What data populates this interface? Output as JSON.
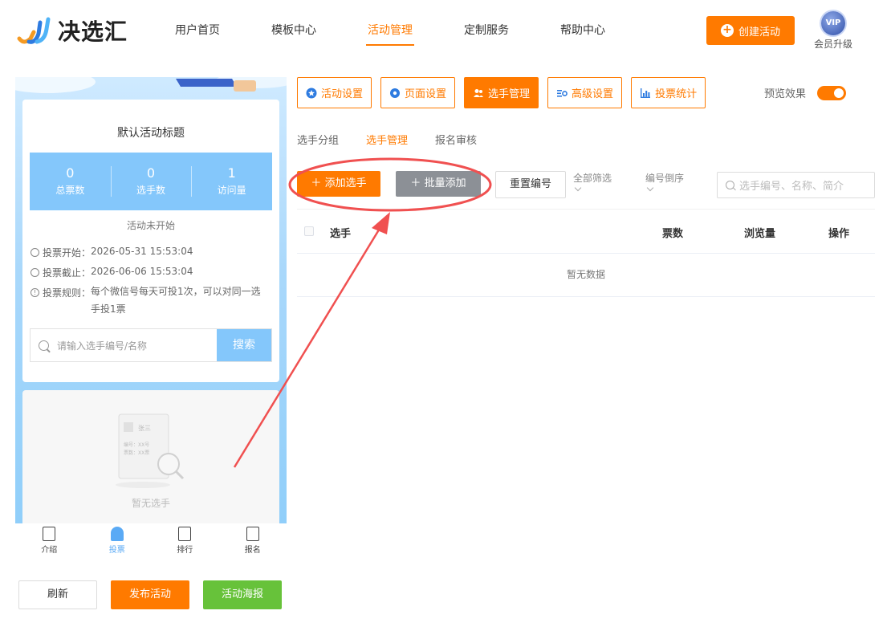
{
  "brand": {
    "name": "决选汇"
  },
  "nav": [
    {
      "label": "用户首页",
      "active": false
    },
    {
      "label": "模板中心",
      "active": false
    },
    {
      "label": "活动管理",
      "active": true
    },
    {
      "label": "定制服务",
      "active": false
    },
    {
      "label": "帮助中心",
      "active": false
    }
  ],
  "header": {
    "create_label": "创建活动",
    "vip_badge": "VIP",
    "vip_label": "会员升级"
  },
  "preview": {
    "title": "默认活动标题",
    "stats": [
      {
        "value": "0",
        "label": "总票数"
      },
      {
        "value": "0",
        "label": "选手数"
      },
      {
        "value": "1",
        "label": "访问量"
      }
    ],
    "status": "活动未开始",
    "vote_start_label": "投票开始：",
    "vote_start": "2026-05-31 15:53:04",
    "vote_end_label": "投票截止：",
    "vote_end": "2026-06-06 15:53:04",
    "rule_label": "投票规则：",
    "rule": "每个微信号每天可投1次，可以对同一选手投1票",
    "search_placeholder": "请输入选手编号/名称",
    "search_button": "搜索",
    "empty_sample_name": "张三",
    "empty_sample_no": "编号：XX号",
    "empty_sample_votes": "票数：XX票",
    "empty_text": "暂无选手",
    "tabbar": [
      {
        "label": "介绍",
        "icon": "intro-icon",
        "active": false
      },
      {
        "label": "投票",
        "icon": "vote-user-icon",
        "active": true
      },
      {
        "label": "排行",
        "icon": "ranking-icon",
        "active": false
      },
      {
        "label": "报名",
        "icon": "signup-icon",
        "active": false
      }
    ]
  },
  "bottom_buttons": {
    "refresh": "刷新",
    "publish": "发布活动",
    "poster": "活动海报"
  },
  "toolbar": [
    {
      "label": "活动设置",
      "icon": "star-icon",
      "active": false
    },
    {
      "label": "页面设置",
      "icon": "flower-settings-icon",
      "active": false
    },
    {
      "label": "选手管理",
      "icon": "users-icon",
      "active": true
    },
    {
      "label": "高级设置",
      "icon": "advanced-settings-icon",
      "active": false
    },
    {
      "label": "投票统计",
      "icon": "bar-chart-icon",
      "active": false
    }
  ],
  "preview_toggle": {
    "label": "预览效果",
    "on": true
  },
  "subtabs": [
    {
      "label": "选手分组",
      "active": false
    },
    {
      "label": "选手管理",
      "active": true
    },
    {
      "label": "报名审核",
      "active": false
    }
  ],
  "actions": {
    "add": "添加选手",
    "batch_add": "批量添加",
    "reset_numbers": "重置编号",
    "filter_all": "全部筛选",
    "sort_desc": "编号倒序",
    "search_placeholder": "选手编号、名称、简介"
  },
  "table": {
    "columns": [
      "选手",
      "票数",
      "浏览量",
      "操作"
    ],
    "empty": "暂无数据"
  },
  "colors": {
    "accent": "#ff7a00",
    "preview_blue": "#84c7fb",
    "green": "#67c23a",
    "annotation_red": "#f05050"
  }
}
